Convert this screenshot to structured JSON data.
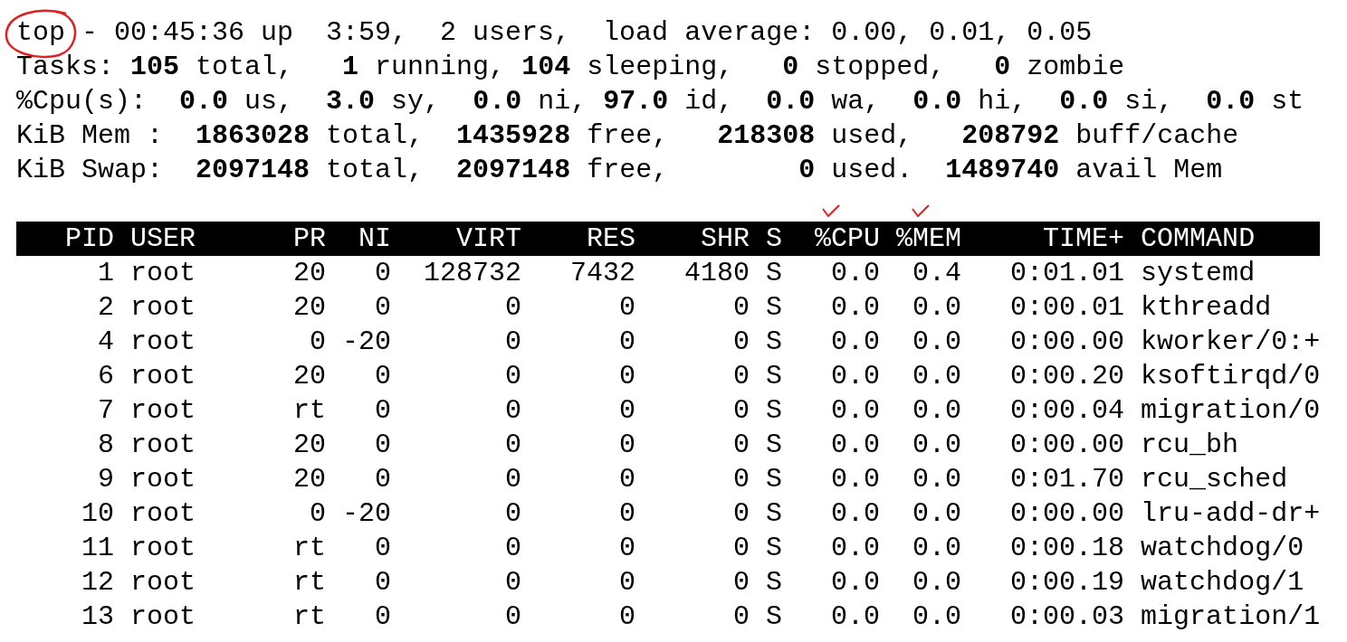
{
  "uptime_line": {
    "program": {
      "text": "top",
      "circled": true
    },
    "text": " - 00:45:36 up  3:59,  2 users,  load average: 0.00, 0.01, 0.05"
  },
  "summary_lines": [
    "Tasks: **105** total,   **1** running, **104** sleeping,   **0** stopped,   **0** zombie",
    "%Cpu(s):  **0.0** us,  **3.0** sy,  **0.0** ni, **97.0** id,  **0.0** wa,  **0.0** hi,  **0.0** si,  **0.0** st",
    "KiB Mem :  **1863028** total,  **1435928** free,   **218308** used,   **208792** buff/cache",
    "KiB Swap:  **2097148** total,  **2097148** free,        **0** used.  **1489740** avail Mem"
  ],
  "table": {
    "columns": [
      {
        "label": "PID",
        "checked": false
      },
      {
        "label": "USER",
        "checked": false
      },
      {
        "label": "PR",
        "checked": false
      },
      {
        "label": "NI",
        "checked": false
      },
      {
        "label": "VIRT",
        "checked": false
      },
      {
        "label": "RES",
        "checked": false
      },
      {
        "label": "SHR",
        "checked": false
      },
      {
        "label": "S",
        "checked": false
      },
      {
        "label": "%CPU",
        "checked": true
      },
      {
        "label": "%MEM",
        "checked": true
      },
      {
        "label": "TIME+",
        "checked": false
      },
      {
        "label": "COMMAND",
        "checked": false
      }
    ],
    "rows": [
      [
        "1",
        "root",
        "20",
        "0",
        "128732",
        "7432",
        "4180",
        "S",
        "0.0",
        "0.4",
        "0:01.01",
        "systemd"
      ],
      [
        "2",
        "root",
        "20",
        "0",
        "0",
        "0",
        "0",
        "S",
        "0.0",
        "0.0",
        "0:00.01",
        "kthreadd"
      ],
      [
        "4",
        "root",
        "0",
        "-20",
        "0",
        "0",
        "0",
        "S",
        "0.0",
        "0.0",
        "0:00.00",
        "kworker/0:+"
      ],
      [
        "6",
        "root",
        "20",
        "0",
        "0",
        "0",
        "0",
        "S",
        "0.0",
        "0.0",
        "0:00.20",
        "ksoftirqd/0"
      ],
      [
        "7",
        "root",
        "rt",
        "0",
        "0",
        "0",
        "0",
        "S",
        "0.0",
        "0.0",
        "0:00.04",
        "migration/0"
      ],
      [
        "8",
        "root",
        "20",
        "0",
        "0",
        "0",
        "0",
        "S",
        "0.0",
        "0.0",
        "0:00.00",
        "rcu_bh"
      ],
      [
        "9",
        "root",
        "20",
        "0",
        "0",
        "0",
        "0",
        "S",
        "0.0",
        "0.0",
        "0:01.70",
        "rcu_sched"
      ],
      [
        "10",
        "root",
        "0",
        "-20",
        "0",
        "0",
        "0",
        "S",
        "0.0",
        "0.0",
        "0:00.00",
        "lru-add-dr+"
      ],
      [
        "11",
        "root",
        "rt",
        "0",
        "0",
        "0",
        "0",
        "S",
        "0.0",
        "0.0",
        "0:00.18",
        "watchdog/0"
      ],
      [
        "12",
        "root",
        "rt",
        "0",
        "0",
        "0",
        "0",
        "S",
        "0.0",
        "0.0",
        "0:00.19",
        "watchdog/1"
      ],
      [
        "13",
        "root",
        "rt",
        "0",
        "0",
        "0",
        "0",
        "S",
        "0.0",
        "0.0",
        "0:00.03",
        "migration/1"
      ]
    ]
  }
}
